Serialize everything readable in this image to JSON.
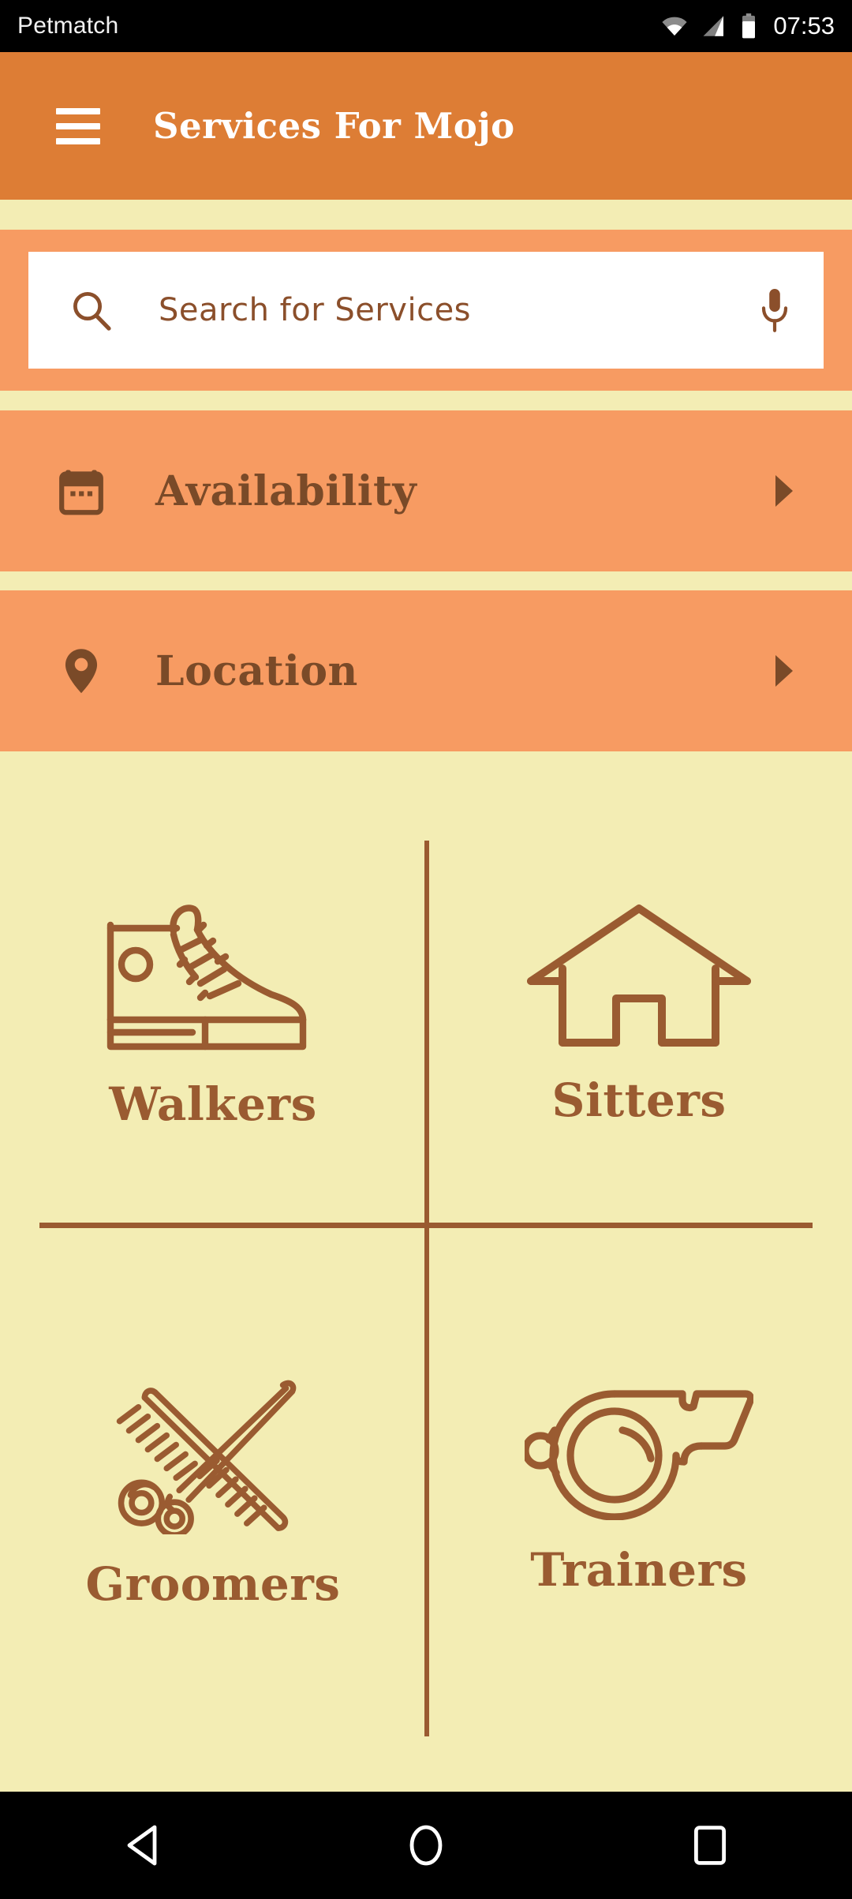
{
  "statusbar": {
    "app_name": "Petmatch",
    "clock": "07:53",
    "icons": [
      "wifi-icon",
      "cell-signal-icon",
      "battery-icon"
    ]
  },
  "appbar": {
    "menu_icon": "hamburger-menu-icon",
    "title": "Services For Mojo",
    "background_color": "#DD7D35",
    "title_color": "#FFFFFF"
  },
  "search": {
    "placeholder": "Search for Services",
    "value": "",
    "search_icon": "search-icon",
    "mic_icon": "microphone-icon",
    "band_color": "#F79B62",
    "field_color": "#FFFFFF",
    "text_color": "#8B4F2B"
  },
  "filters": [
    {
      "label": "Availability",
      "icon": "calendar-icon",
      "arrow": "chevron-right-icon"
    },
    {
      "label": "Location",
      "icon": "map-pin-icon",
      "arrow": "chevron-right-icon"
    }
  ],
  "services": [
    {
      "label": "Walkers",
      "icon": "sneaker-icon"
    },
    {
      "label": "Sitters",
      "icon": "house-icon"
    },
    {
      "label": "Groomers",
      "icon": "scissors-comb-icon"
    },
    {
      "label": "Trainers",
      "icon": "whistle-icon"
    }
  ],
  "theme": {
    "page_background": "#F3EDB4",
    "accent_orange": "#DD7D35",
    "light_orange": "#F79B62",
    "brown": "#9A5B31",
    "dark_brown": "#7A4A28"
  },
  "navbar": {
    "back": "back-triangle-icon",
    "home": "home-circle-icon",
    "recents": "recents-square-icon"
  }
}
